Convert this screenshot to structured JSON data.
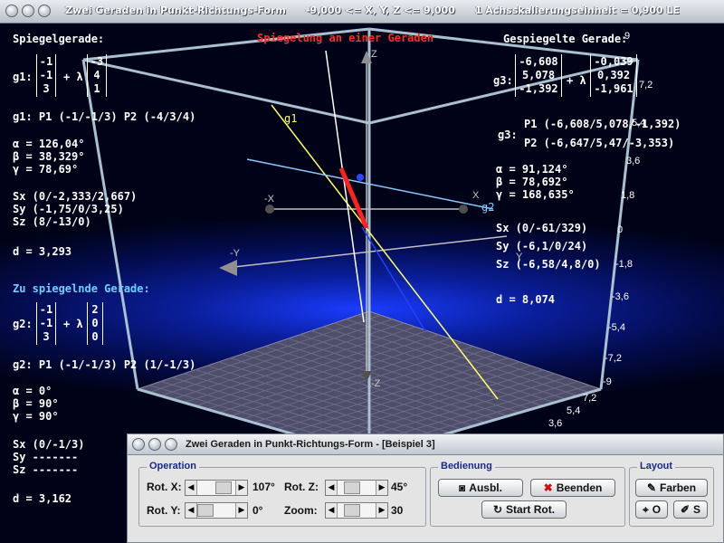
{
  "window": {
    "title_parts": [
      "Zwei Geraden in Punkt-Richtungs-Form",
      "-9,000 <= X, Y, Z <= 9,000",
      "1 Achsskalierungseinheit = 0,900 LE"
    ]
  },
  "left": {
    "mirror_title": "Spiegelgerade:",
    "g1_name": "g1:",
    "g1_point": [
      "-1",
      "-1",
      "3"
    ],
    "g1_dir": [
      "-3",
      "4",
      "1"
    ],
    "lambda": "+ λ",
    "g1_points": "g1:  P1 (-1/-1/3)   P2 (-4/3/4)",
    "g1_alpha": "α = 126,04°",
    "g1_beta": "β = 38,329°",
    "g1_gamma": "γ = 78,69°",
    "g1_sx": "Sx (0/-2,333/2,667)",
    "g1_sy": "Sy (-1,75/0/3,25)",
    "g1_sz": "Sz (8/-13/0)",
    "g1_d": "d = 3,293",
    "to_mirror_title": "Zu spiegelnde Gerade:",
    "g2_name": "g2:",
    "g2_point": [
      "-1",
      "-1",
      "3"
    ],
    "g2_dir": [
      "2",
      "0",
      "0"
    ],
    "g2_points": "g2:  P1 (-1/-1/3)   P2 (1/-1/3)",
    "g2_alpha": "α = 0°",
    "g2_beta": "β = 90°",
    "g2_gamma": "γ =  90°",
    "g2_sx": "Sx (0/-1/3)",
    "g2_sy": "Sy -------",
    "g2_sz": "Sz -------",
    "g2_d": "d = 3,162"
  },
  "right": {
    "title": "Gespiegelte Gerade:",
    "g3_name": "g3:",
    "g3_point": [
      "-6,608",
      "5,078",
      "-1,392"
    ],
    "g3_dir": [
      "-0,039",
      "0,392",
      "-1,961"
    ],
    "lambda": "+ λ",
    "g3_label": "g3:",
    "g3_p1": "P1 (-6,608/5,078/-1,392)",
    "g3_p2": "P2 (-6,647/5,47/-3,353)",
    "g3_alpha": "α = 91,124°",
    "g3_beta": "β = 78,692°",
    "g3_gamma": "γ = 168,635°",
    "g3_sx": "Sx (0/-61/329)",
    "g3_sy": "Sy (-6,1/0/24)",
    "g3_sz": "Sz (-6,58/4,8/0)",
    "g3_d": "d = 8,074"
  },
  "center_title": "Spiegelung an einer Geraden",
  "scale_labels": [
    "9",
    "7,2",
    "5,4",
    "3,6",
    "1,8",
    "0",
    "-1,8",
    "-3,6",
    "-5,4",
    "-7,2",
    "-9",
    "7,2",
    "5,4",
    "3,6"
  ],
  "plot_labels": {
    "g1": "g1",
    "g2": "g2",
    "axis_x": "X",
    "axis_neg_x": "-X",
    "axis_y": "Y",
    "axis_neg_y": "-Y",
    "axis_z": "Z",
    "axis_neg_z": "-Z"
  },
  "panel": {
    "title": "Zwei Geraden in Punkt-Richtungs-Form - [Beispiel 3]",
    "operation_label": "Operation",
    "rotx_label": "Rot. X:",
    "rotx_value": "107°",
    "roty_label": "Rot. Y:",
    "roty_value": "0°",
    "rotz_label": "Rot. Z:",
    "rotz_value": "45°",
    "zoom_label": "Zoom:",
    "zoom_value": "30",
    "bedienung_label": "Bedienung",
    "ausbl": "Ausbl.",
    "beenden": "Beenden",
    "start_rot": "Start Rot.",
    "layout_label": "Layout",
    "farben": "Farben",
    "o_btn": "O",
    "s_btn": "S"
  },
  "colors": {
    "g1": "#ffff66",
    "g2": "#88c8ff",
    "g3": "#ffffff",
    "mirror_seg": "#ff2020",
    "bg_accent": "#1a3cff",
    "heading_cyan": "#6ad0ff"
  }
}
